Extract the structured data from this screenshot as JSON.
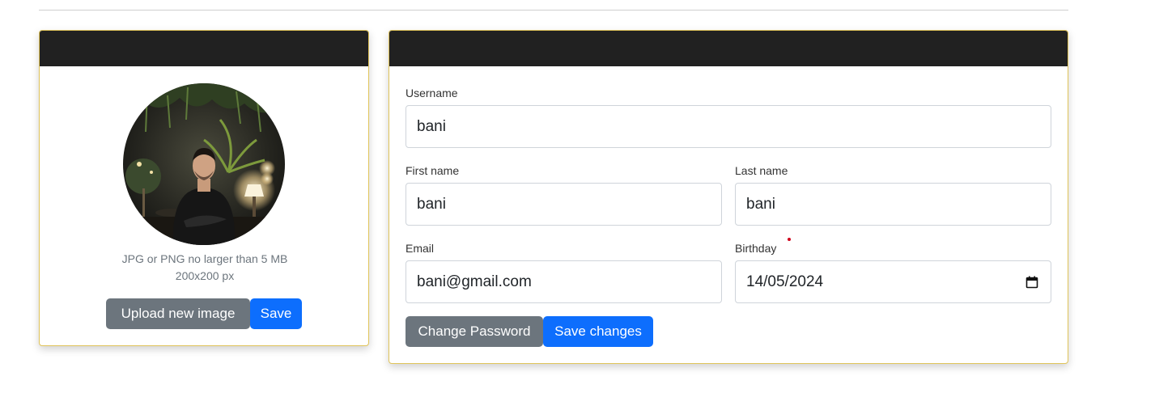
{
  "photo_card": {
    "header_title": "",
    "hint_line1": "JPG or PNG no larger than 5 MB",
    "hint_line2": "200x200 px",
    "upload_label": "Upload new image",
    "save_label": "Save"
  },
  "details_card": {
    "header_title": "",
    "username": {
      "label": "Username",
      "value": "bani"
    },
    "first_name": {
      "label": "First name",
      "value": "bani"
    },
    "last_name": {
      "label": "Last name",
      "value": "bani"
    },
    "email": {
      "label": "Email",
      "value": "bani@gmail.com"
    },
    "birthday": {
      "label": "Birthday",
      "value": "14/05/2024"
    },
    "change_password_label": "Change Password",
    "save_changes_label": "Save changes"
  },
  "colors": {
    "header_bg": "#212121",
    "card_border": "#e0c45a",
    "secondary": "#6c757d",
    "primary": "#0d6efd",
    "required_dot": "#d0021b"
  },
  "icons": {
    "birthday_picker": "calendar-icon"
  }
}
